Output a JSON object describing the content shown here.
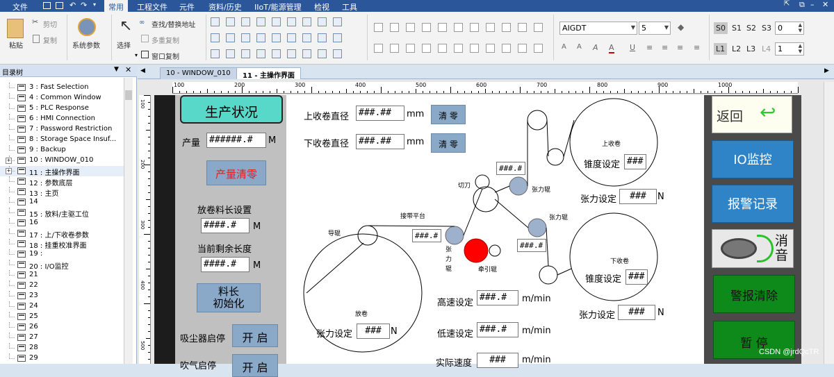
{
  "menubar": {
    "items": [
      "文件",
      "常用",
      "工程文件",
      "元件",
      "资料/历史",
      "IIoT/能源管理",
      "检视",
      "工具"
    ]
  },
  "ribbon": {
    "paste": "粘贴",
    "cut": "剪切",
    "copy": "复制",
    "system_params": "系统参数",
    "select": "选择",
    "find_replace": "查找/替换地址",
    "multi_copy": "多重复制",
    "window_copy": "窗口复制",
    "font_combo": "AIGDT",
    "size_combo": "5",
    "state_buttons": [
      "S0",
      "S1",
      "S2",
      "S3"
    ],
    "state_value": "0",
    "layer_buttons": [
      "L1",
      "L2",
      "L3",
      "L4"
    ],
    "layer_value": "1"
  },
  "tree": {
    "title": "目录树",
    "items": [
      "3 : Fast Selection",
      "4 : Common Window",
      "5 : PLC Response",
      "6 : HMI Connection",
      "7 : Password Restriction",
      "8 : Storage Space Insuf...",
      "9 : Backup",
      "10 : WINDOW_010",
      "11 : 主操作界面",
      "12 : 参数底层",
      "13 : 主页",
      "14",
      "15 : 放料/主驱工位",
      "16",
      "17 : 上/下收卷参数",
      "18 : 挂重校准界面",
      "19 :",
      "20 : I/O监控",
      "21",
      "22",
      "23",
      "24",
      "25",
      "26",
      "27",
      "28",
      "29"
    ]
  },
  "tabs": [
    "10 - WINDOW_010",
    "11 - 主操作界面"
  ],
  "ruler": {
    "h": [
      "100",
      "200",
      "300",
      "400",
      "500",
      "600",
      "700",
      "800",
      "900",
      "1000"
    ],
    "v": [
      "100",
      "200",
      "300",
      "400",
      "500"
    ]
  },
  "hmi": {
    "title": "生产状况",
    "output_label": "产量",
    "output_value": "######.#",
    "output_unit": "M",
    "clear_output": "产量清零",
    "unwind_len_label": "放卷料长设置",
    "unwind_len_value": "####.#",
    "unwind_len_unit": "M",
    "remain_label": "当前剩余长度",
    "remain_value": "####.#",
    "remain_unit": "M",
    "init_btn_line1": "料长",
    "init_btn_line2": "初始化",
    "vacuum_label": "吸尘器启停",
    "vacuum_btn": "开 启",
    "blow_label": "吹气启停",
    "blow_btn": "开 启",
    "up_dia_label": "上收卷直径",
    "up_dia_value": "###.##",
    "up_dia_unit": "mm",
    "up_clear": "清 零",
    "down_dia_label": "下收卷直径",
    "down_dia_value": "###.##",
    "down_dia_unit": "mm",
    "down_clear": "清 零",
    "cutter": "切刀",
    "tension_roll_a": "张力辊",
    "tension_roll_b": "张力辊",
    "roller_val_a": "###.#",
    "roller_val_b": "###.#",
    "roller_val_c": "###.#",
    "platform": "接带平台",
    "guide_roll": "导辊",
    "tension_roll_c_1": "张",
    "tension_roll_c_2": "力",
    "tension_roll_c_3": "辊",
    "traction_roll": "牵引辊",
    "up_winder": "上收卷",
    "up_taper_label": "锥度设定",
    "up_taper_value": "###",
    "up_tension_label": "张力设定",
    "up_tension_value": "###",
    "up_tension_unit": "N",
    "down_winder": "下收卷",
    "down_taper_label": "锥度设定",
    "down_taper_value": "###",
    "down_tension_label": "张力设定",
    "down_tension_value": "###",
    "down_tension_unit": "N",
    "unwinder": "放卷",
    "unwind_tension_label": "张力设定",
    "unwind_tension_value": "###",
    "unwind_tension_unit": "N",
    "high_speed_label": "高速设定",
    "high_speed_value": "###.#",
    "high_speed_unit": "m/min",
    "low_speed_label": "低速设定",
    "low_speed_value": "###.#",
    "low_speed_unit": "m/min",
    "actual_speed_label": "实际速度",
    "actual_speed_value": "###",
    "actual_speed_unit": "m/min",
    "back_btn": "返回",
    "io_btn": "IO监控",
    "alarm_log_btn": "报警记录",
    "mute_line1": "消",
    "mute_line2": "音",
    "alarm_clear_btn": "警报清除",
    "pause_btn": "暂 停"
  },
  "watermark": "CSDN @jrdQcTR"
}
